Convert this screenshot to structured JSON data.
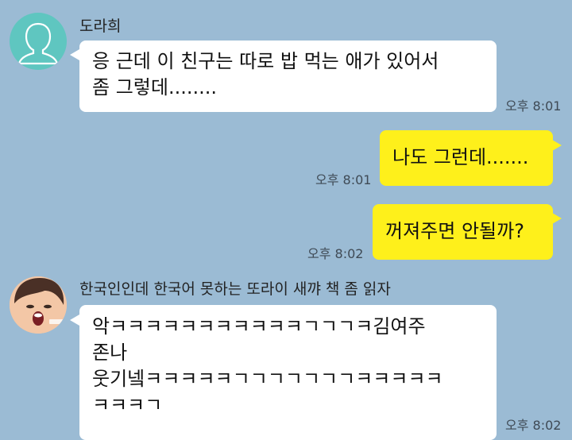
{
  "colors": {
    "chat_background": "#9bbbd4",
    "incoming_bubble": "#ffffff",
    "outgoing_bubble": "#fef01b",
    "default_avatar": "#5fc6c0"
  },
  "messages": [
    {
      "sender": "도라희",
      "avatar": "default-person-icon",
      "lines": [
        "응 근데 이 친구는 따로 밥 먹는 애가 있어서",
        "좀 그렇데........"
      ],
      "time": "오후 8:01"
    },
    {
      "direction": "outgoing",
      "lines": [
        "나도 그런데......."
      ],
      "time": "오후 8:01"
    },
    {
      "direction": "outgoing",
      "lines": [
        "꺼져주면 안될까?"
      ],
      "time": "오후 8:02"
    },
    {
      "sender": "한국인인데 한국어 못하는 또라이 새꺄 책 좀 읽자",
      "avatar": "profile-photo",
      "lines": [
        "악ㅋㅋㅋㅋㅋㅋㅋㅋㅋㅋㅋㄱㄱㄱㅋ김여주",
        "존나",
        "웃기넼ㅋㅋㅋㅋㅋㄱㄱㄱㄱㄱㄱㄱㅋㅋㅋㅋㅋ",
        "ㅋㅋㅋㄱ"
      ],
      "time": "오후 8:02"
    }
  ]
}
